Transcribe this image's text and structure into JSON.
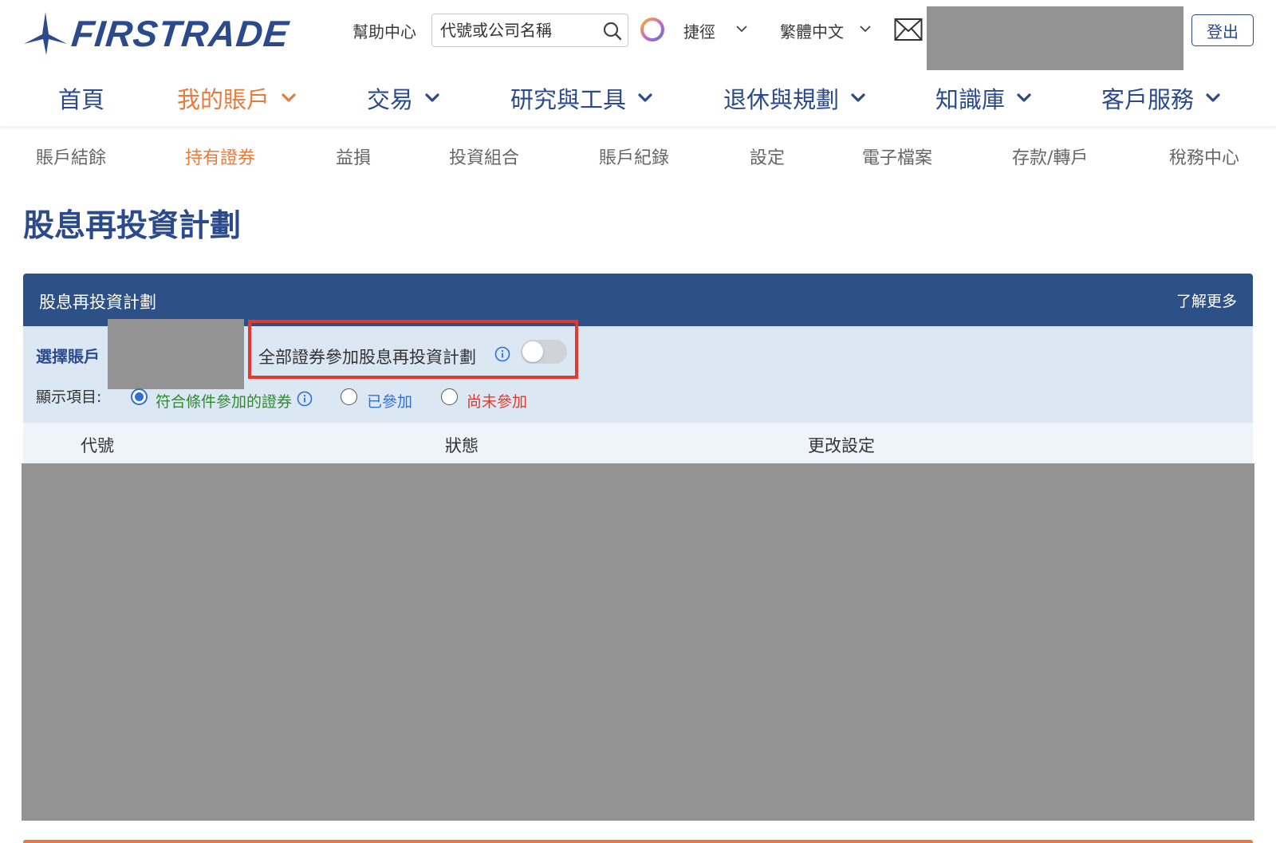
{
  "brand": {
    "name": "FIRSTRADE",
    "color": "#2b4a8b",
    "accent": "#e87a3c"
  },
  "topbar": {
    "help": "幫助中心",
    "search_placeholder": "代號或公司名稱",
    "shortcut": "捷徑",
    "language": "繁體中文",
    "logout": "登出"
  },
  "mainnav": {
    "items": [
      {
        "label": "首頁"
      },
      {
        "label": "我的賬戶",
        "active": true
      },
      {
        "label": "交易"
      },
      {
        "label": "研究與工具"
      },
      {
        "label": "退休與規劃"
      },
      {
        "label": "知識庫"
      },
      {
        "label": "客戶服務"
      }
    ]
  },
  "subnav": {
    "items": [
      {
        "label": "賬戶結餘"
      },
      {
        "label": "持有證券",
        "active": true
      },
      {
        "label": "益損"
      },
      {
        "label": "投資組合"
      },
      {
        "label": "賬戶紀錄"
      },
      {
        "label": "設定"
      },
      {
        "label": "電子檔案"
      },
      {
        "label": "存款/轉戶"
      },
      {
        "label": "稅務中心"
      }
    ]
  },
  "page": {
    "title": "股息再投資計劃"
  },
  "panel": {
    "title": "股息再投資計劃",
    "learn_more": "了解更多",
    "select_account": "選擇賬戶",
    "all_securities_drip": "全部證券參加股息再投資計劃",
    "drip_toggle_on": false,
    "show_items": "顯示項目:",
    "filters": [
      {
        "label": "符合條件參加的證券",
        "color": "#2e8b2e",
        "checked": true
      },
      {
        "label": "已參加",
        "color": "#2f6fd6",
        "checked": false
      },
      {
        "label": "尚未參加",
        "color": "#e0392b",
        "checked": false
      }
    ]
  },
  "table": {
    "columns": [
      "代號",
      "狀態",
      "更改設定"
    ]
  },
  "icons": {
    "search": "search-icon",
    "ring": "color-ring-icon",
    "mail": "mail-icon",
    "info": "info-icon",
    "chevron": "chevron-down-icon"
  }
}
